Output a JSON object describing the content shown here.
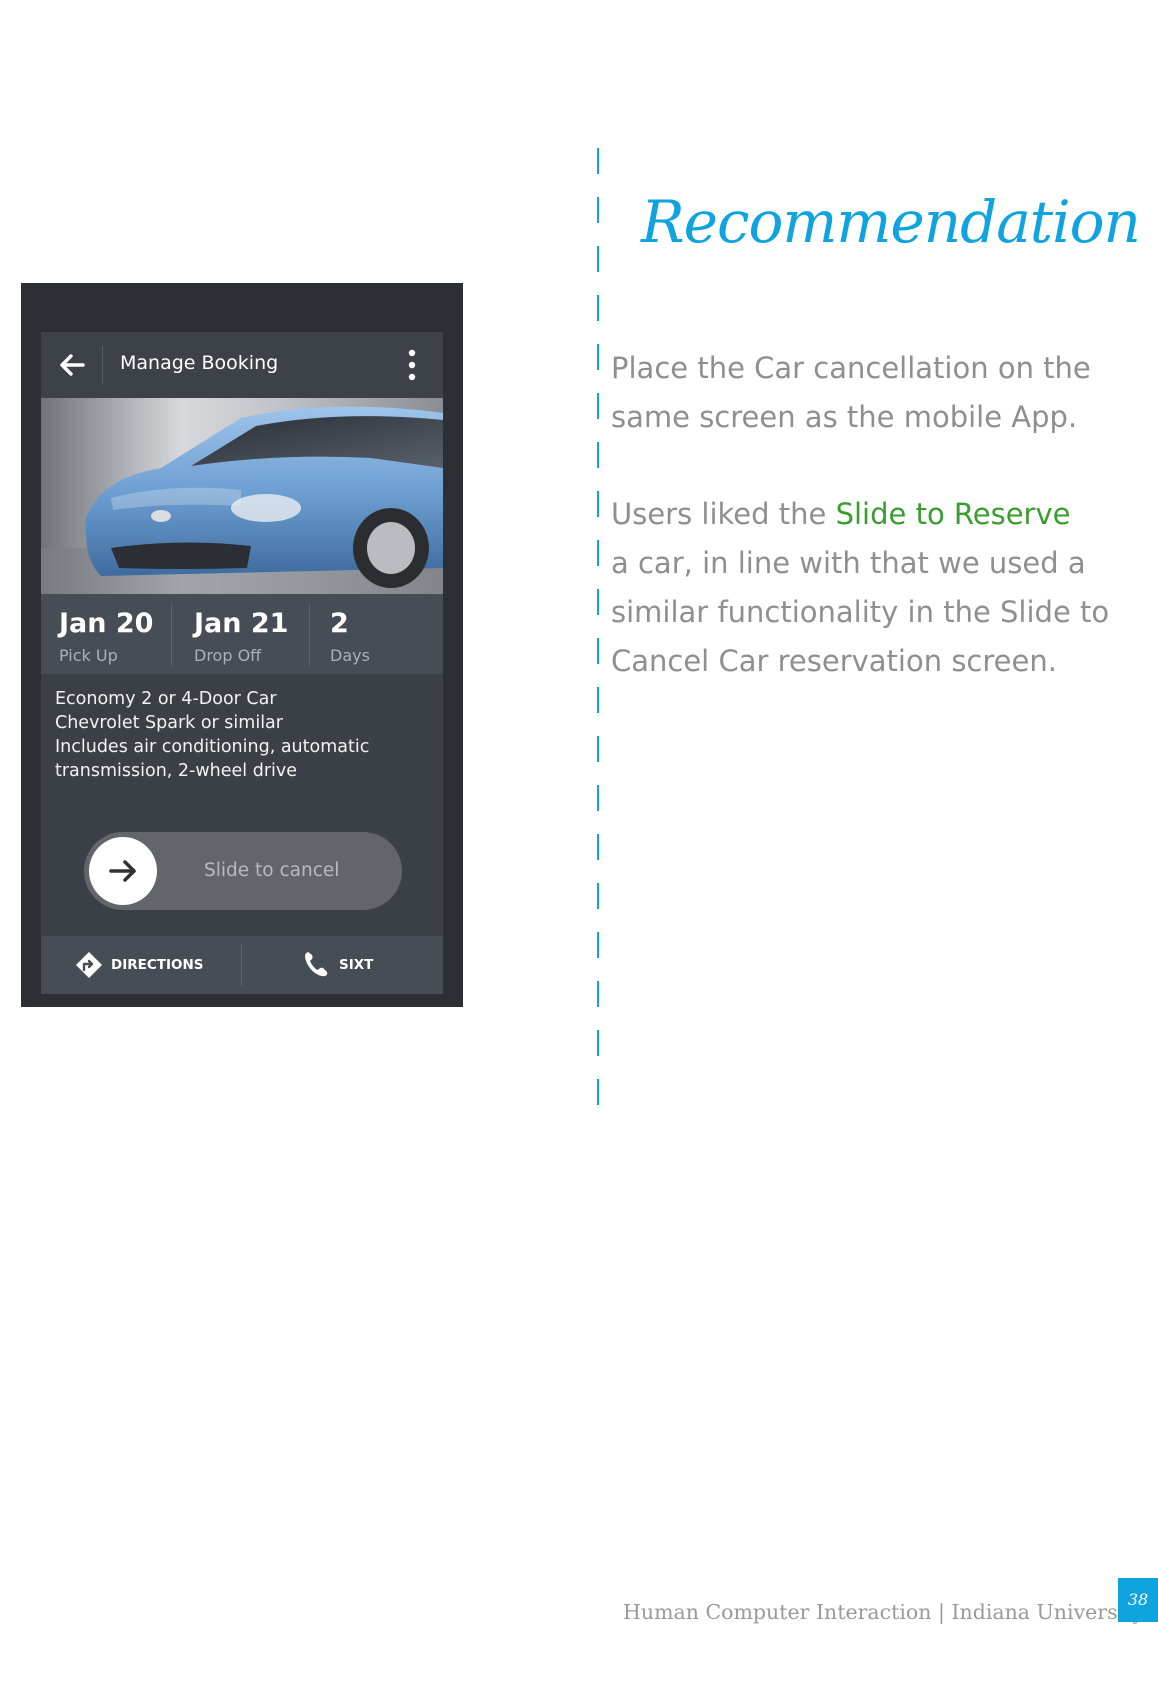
{
  "heading": "Recommendation",
  "paragraph1": [
    "Place the Car cancellation on the",
    "same screen as the mobile App."
  ],
  "paragraph2": {
    "line1_prefix": "Users liked the ",
    "line1_highlight": "Slide to Reserve",
    "lines": [
      "a car, in line with that we used a",
      "similar functionality in the Slide to",
      "Cancel Car reservation screen."
    ]
  },
  "footer": "Human Computer Interaction | Indiana University",
  "page_number": "38",
  "colors": {
    "accent": "#0fa3df",
    "highlight": "#3a9d2f",
    "body_text": "#8f8f8f"
  },
  "phone": {
    "appbar_title": "Manage Booking",
    "icons": {
      "back": "arrow-left-icon",
      "more": "more-vert-icon",
      "slider": "arrow-right-icon",
      "directions": "directions-icon",
      "call": "phone-icon"
    },
    "dates": [
      {
        "value": "Jan 20",
        "label": "Pick Up"
      },
      {
        "value": "Jan 21",
        "label": "Drop Off"
      },
      {
        "value": "2",
        "label": "Days"
      }
    ],
    "details": [
      "Economy 2 or 4-Door Car",
      "Chevrolet Spark or similar",
      "Includes air conditioning, automatic",
      "transmission, 2-wheel drive"
    ],
    "slider_label": "Slide to cancel",
    "actions": [
      "DIRECTIONS",
      "SIXT"
    ]
  }
}
